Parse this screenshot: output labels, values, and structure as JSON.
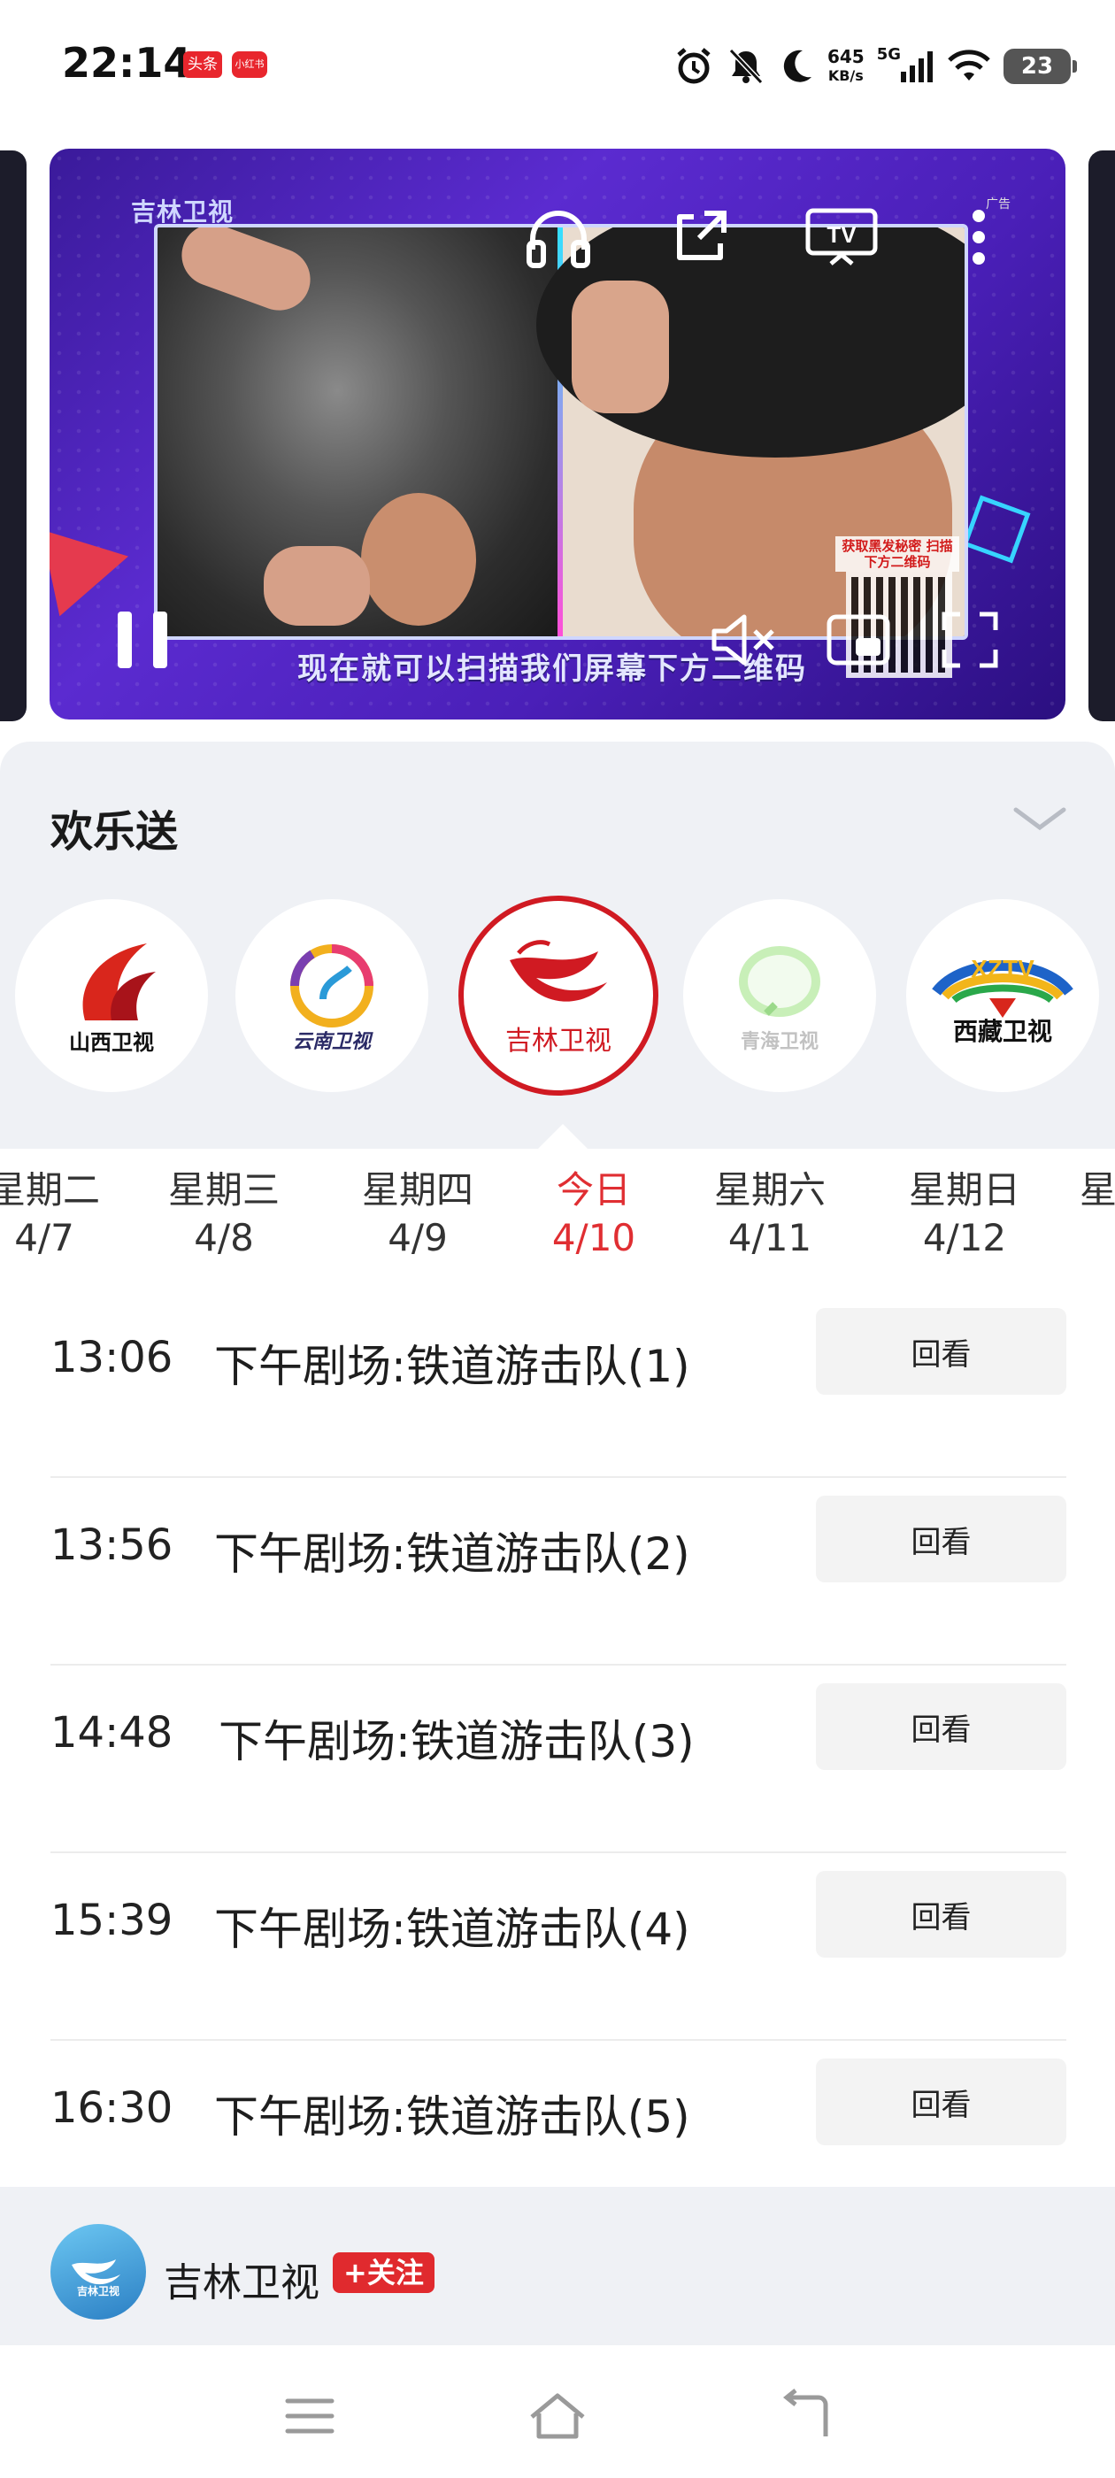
{
  "status_bar": {
    "time": "22:14",
    "badge_1": "头条",
    "badge_2": "小红书",
    "net_speed_value": "645",
    "net_speed_unit": "KB/s",
    "network": "5G",
    "battery": "23"
  },
  "video": {
    "channel_watermark": "吉林卫视",
    "ad_label": "广告",
    "qr_caption": "获取黑发秘密 扫描下方二维码",
    "subtitle": "现在就可以扫描我们屏幕下方二维码"
  },
  "program": {
    "title": "欢乐送"
  },
  "channels": [
    {
      "name": "山西卫视",
      "icon": "shanxi-tv-logo",
      "color": "#d9261c"
    },
    {
      "name": "云南卫视",
      "icon": "yunnan-tv-logo",
      "color": "#7a3fb0"
    },
    {
      "name": "吉林卫视",
      "icon": "jilin-tv-logo",
      "color": "#d01a22",
      "selected": true
    },
    {
      "name": "青海卫视",
      "icon": "qinghai-tv-logo",
      "color": "#8fcf7a"
    },
    {
      "name": "西藏卫视",
      "icon": "xizang-tv-logo",
      "color": "#1a1a1a",
      "logo_text": "XZTV"
    }
  ],
  "days": [
    {
      "weekday": "星期二",
      "date": "4/7"
    },
    {
      "weekday": "星期三",
      "date": "4/8"
    },
    {
      "weekday": "星期四",
      "date": "4/9"
    },
    {
      "weekday": "今日",
      "date": "4/10",
      "active": true
    },
    {
      "weekday": "星期六",
      "date": "4/11"
    },
    {
      "weekday": "星期日",
      "date": "4/12"
    },
    {
      "weekday": "星",
      "date": ""
    }
  ],
  "schedule": [
    {
      "time": "13:06",
      "title": "下午剧场:铁道游击队(1)",
      "action": "回看"
    },
    {
      "time": "13:56",
      "title": "下午剧场:铁道游击队(2)",
      "action": "回看"
    },
    {
      "time": "14:48",
      "title": "下午剧场:铁道游击队(3)",
      "action": "回看"
    },
    {
      "time": "15:39",
      "title": "下午剧场:铁道游击队(4)",
      "action": "回看"
    },
    {
      "time": "16:30",
      "title": "下午剧场:铁道游击队(5)",
      "action": "回看"
    }
  ],
  "footer": {
    "channel_name": "吉林卫视",
    "avatar_text": "吉林卫视",
    "follow_label": "+关注"
  },
  "colors": {
    "accent": "#e02e32",
    "sheet_bg": "#eff1f5"
  }
}
